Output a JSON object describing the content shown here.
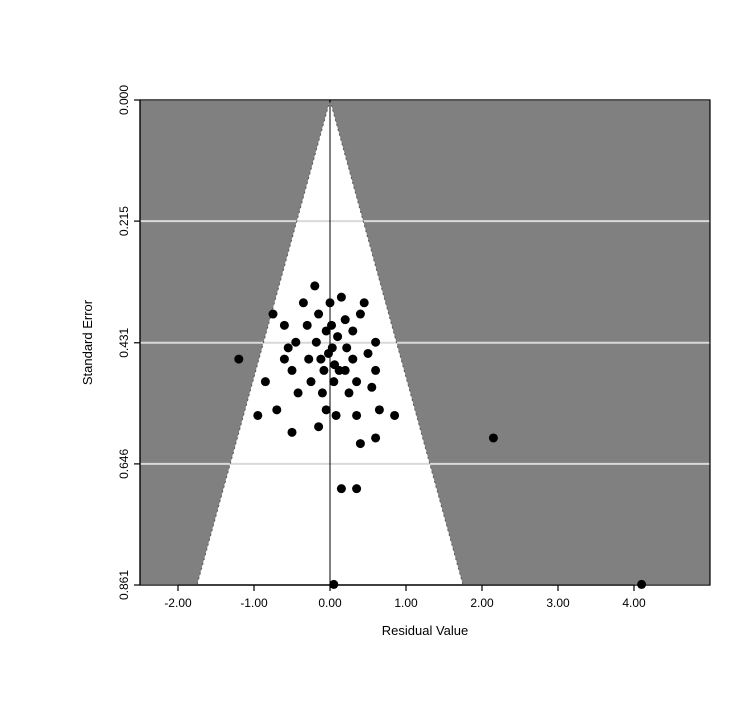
{
  "chart_data": {
    "type": "scatter",
    "title": "",
    "xlabel": "Residual Value",
    "ylabel": "Standard Error",
    "xlim": [
      -2.5,
      5.0
    ],
    "ylim_top": 0.0,
    "ylim_bottom": 0.861,
    "x_ticks": [
      -2.0,
      -1.0,
      0.0,
      1.0,
      2.0,
      3.0,
      4.0
    ],
    "y_ticks": [
      0.0,
      0.215,
      0.431,
      0.646,
      0.861
    ],
    "funnel_apex_x": 0.0,
    "funnel_half_width_at_bottom": 1.75,
    "points": [
      {
        "x": -1.2,
        "y": 0.46
      },
      {
        "x": -0.75,
        "y": 0.38
      },
      {
        "x": -0.6,
        "y": 0.4
      },
      {
        "x": -0.85,
        "y": 0.5
      },
      {
        "x": -0.45,
        "y": 0.43
      },
      {
        "x": -0.95,
        "y": 0.56
      },
      {
        "x": -0.7,
        "y": 0.55
      },
      {
        "x": -0.5,
        "y": 0.59
      },
      {
        "x": -0.35,
        "y": 0.36
      },
      {
        "x": -0.3,
        "y": 0.4
      },
      {
        "x": -0.28,
        "y": 0.46
      },
      {
        "x": -0.25,
        "y": 0.5
      },
      {
        "x": -0.2,
        "y": 0.33
      },
      {
        "x": -0.18,
        "y": 0.43
      },
      {
        "x": -0.15,
        "y": 0.38
      },
      {
        "x": -0.12,
        "y": 0.46
      },
      {
        "x": -0.1,
        "y": 0.52
      },
      {
        "x": -0.08,
        "y": 0.48
      },
      {
        "x": -0.05,
        "y": 0.41
      },
      {
        "x": -0.02,
        "y": 0.45
      },
      {
        "x": 0.0,
        "y": 0.36
      },
      {
        "x": 0.02,
        "y": 0.4
      },
      {
        "x": 0.03,
        "y": 0.44
      },
      {
        "x": 0.05,
        "y": 0.5
      },
      {
        "x": 0.06,
        "y": 0.47
      },
      {
        "x": 0.08,
        "y": 0.56
      },
      {
        "x": 0.1,
        "y": 0.42
      },
      {
        "x": 0.12,
        "y": 0.48
      },
      {
        "x": 0.15,
        "y": 0.35
      },
      {
        "x": 0.2,
        "y": 0.39
      },
      {
        "x": 0.2,
        "y": 0.48
      },
      {
        "x": 0.22,
        "y": 0.44
      },
      {
        "x": 0.25,
        "y": 0.52
      },
      {
        "x": 0.3,
        "y": 0.41
      },
      {
        "x": 0.3,
        "y": 0.46
      },
      {
        "x": 0.35,
        "y": 0.5
      },
      {
        "x": 0.35,
        "y": 0.56
      },
      {
        "x": 0.4,
        "y": 0.38
      },
      {
        "x": 0.4,
        "y": 0.61
      },
      {
        "x": 0.45,
        "y": 0.36
      },
      {
        "x": 0.5,
        "y": 0.45
      },
      {
        "x": 0.55,
        "y": 0.51
      },
      {
        "x": 0.6,
        "y": 0.43
      },
      {
        "x": 0.6,
        "y": 0.48
      },
      {
        "x": 0.6,
        "y": 0.6
      },
      {
        "x": 0.65,
        "y": 0.55
      },
      {
        "x": 0.85,
        "y": 0.56
      },
      {
        "x": 0.05,
        "y": 0.86
      },
      {
        "x": 0.35,
        "y": 0.69
      },
      {
        "x": 0.15,
        "y": 0.69
      },
      {
        "x": -0.05,
        "y": 0.55
      },
      {
        "x": -0.5,
        "y": 0.48
      },
      {
        "x": -0.55,
        "y": 0.44
      },
      {
        "x": -0.42,
        "y": 0.52
      },
      {
        "x": -0.6,
        "y": 0.46
      },
      {
        "x": -0.15,
        "y": 0.58
      },
      {
        "x": 2.15,
        "y": 0.6
      },
      {
        "x": 4.1,
        "y": 0.86
      }
    ],
    "colors": {
      "background_outside_funnel": "#808080",
      "plot_background": "#808080",
      "funnel_fill": "#ffffff",
      "gridline": "#d9d9d9",
      "funnel_edge": "#555555",
      "point_fill": "#000000"
    }
  }
}
